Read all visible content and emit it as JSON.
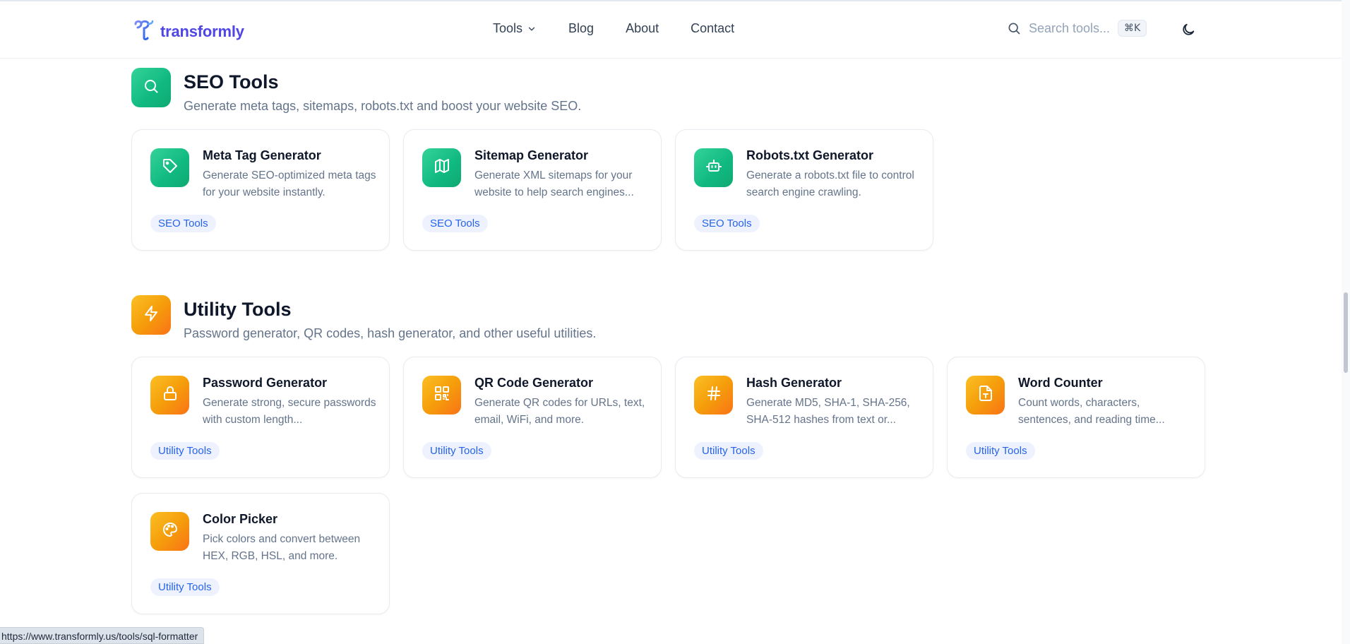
{
  "brand": {
    "name": "transformly",
    "accent": "#4f46e5"
  },
  "nav": {
    "items": [
      {
        "label": "Tools",
        "has_dropdown": true
      },
      {
        "label": "Blog"
      },
      {
        "label": "About"
      },
      {
        "label": "Contact"
      }
    ]
  },
  "search": {
    "placeholder": "Search tools...",
    "shortcut": "⌘K"
  },
  "theme_toggle": {
    "icon": "moon-icon"
  },
  "sections": [
    {
      "title": "SEO Tools",
      "description": "Generate meta tags, sitemaps, robots.txt and boost your website SEO.",
      "icon": "search-icon",
      "color": "#10b981",
      "cards": [
        {
          "title": "Meta Tag Generator",
          "description": "Generate SEO-optimized meta tags for your website instantly.",
          "badge": "SEO Tools",
          "icon": "tag-icon"
        },
        {
          "title": "Sitemap Generator",
          "description": "Generate XML sitemaps for your website to help search engines...",
          "badge": "SEO Tools",
          "icon": "map-icon"
        },
        {
          "title": "Robots.txt Generator",
          "description": "Generate a robots.txt file to control search engine crawling.",
          "badge": "SEO Tools",
          "icon": "bot-icon"
        }
      ]
    },
    {
      "title": "Utility Tools",
      "description": "Password generator, QR codes, hash generator, and other useful utilities.",
      "icon": "zap-icon",
      "color": "#f59e0b",
      "cards": [
        {
          "title": "Password Generator",
          "description": "Generate strong, secure passwords with custom length...",
          "badge": "Utility Tools",
          "icon": "lock-icon"
        },
        {
          "title": "QR Code Generator",
          "description": "Generate QR codes for URLs, text, email, WiFi, and more.",
          "badge": "Utility Tools",
          "icon": "qr-code-icon"
        },
        {
          "title": "Hash Generator",
          "description": "Generate MD5, SHA-1, SHA-256, SHA-512 hashes from text or...",
          "badge": "Utility Tools",
          "icon": "hash-icon"
        },
        {
          "title": "Word Counter",
          "description": "Count words, characters, sentences, and reading time...",
          "badge": "Utility Tools",
          "icon": "file-text-icon"
        },
        {
          "title": "Color Picker",
          "description": "Pick colors and convert between HEX, RGB, HSL, and more.",
          "badge": "Utility Tools",
          "icon": "palette-icon"
        }
      ]
    }
  ],
  "status_bar": {
    "url": "https://www.transformly.us/tools/sql-formatter"
  }
}
